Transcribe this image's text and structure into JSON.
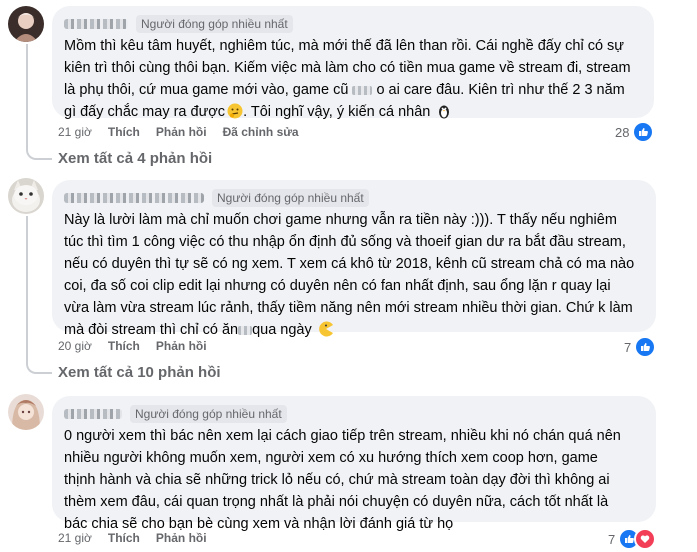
{
  "comments": [
    {
      "badge": "Người đóng góp nhiều nhất",
      "lines": [
        "Mồm thì kêu tâm huyết, nghiêm túc, mà mới thế đã lên than rồi. Cái nghề đấy chỉ có sự",
        "kiên trì thôi cùng thôi bạn. Kiếm việc mà làm cho có tiền mua game về stream đi, stream",
        "là phụ thôi, cứ mua game mới vào, game cũ",
        "o ai care đâu. Kiên trì như thế 2 3 năm",
        "gì đấy chắc may ra được",
        ". Tôi nghĩ vậy, ý kiến cá nhân"
      ],
      "time": "21 giờ",
      "like": "Thích",
      "reply": "Phản hồi",
      "edited": "Đã chỉnh sửa",
      "reaction_count": "28",
      "view_replies": "Xem tất cả 4 phản hồi"
    },
    {
      "badge": "Người đóng góp nhiều nhất",
      "lines": [
        "Này là lười làm mà chỉ muốn chơi game nhưng vẫn ra tiền này :))). T thấy nếu nghiêm",
        "túc thì tìm 1 công việc có thu nhập ổn định đủ sống và thoeif gian dư ra bắt đầu stream,",
        "nếu có duyên thì tự sẽ có ng xem. T xem cá khô từ 2018, kênh cũ stream chả có ma nào",
        "coi, đa số coi clip edit lại nhưng có duyên nên có fan nhất định, sau ổng lặn r quay lại",
        "vừa làm vừa stream lúc rảnh, thấy tiềm năng nên mới stream nhiều thời gian. Chứ k làm",
        "mà đòi stream thì chỉ có ăn",
        "qua ngày"
      ],
      "time": "20 giờ",
      "like": "Thích",
      "reply": "Phản hồi",
      "reaction_count": "7",
      "view_replies": "Xem tất cả 10 phản hồi"
    },
    {
      "badge": "Người đóng góp nhiều nhất",
      "lines": [
        "0 người xem thì bác nên xem lại cách giao tiếp trên stream, nhiều khi nó chán quá nên",
        "nhiều người không muốn xem, người xem có xu hướng thích xem coop hơn, game",
        "thịnh hành và chia sẽ những trick lỏ nếu có, chứ mà stream toàn dạy đời thì không ai",
        "thèm xem đâu, cái quan trọng nhất là phải nói chuyện có duyên nữa, cách tốt nhất là",
        "bác chia sẽ cho bạn bè cùng xem và nhận lời đánh giá từ họ"
      ],
      "time": "21 giờ",
      "like": "Thích",
      "reply": "Phản hồi",
      "reaction_count": "7"
    }
  ],
  "colors": {
    "bubble": "#f0f2f5",
    "meta": "#65676b",
    "like": "#1877f2",
    "heart": "#f33e58"
  }
}
